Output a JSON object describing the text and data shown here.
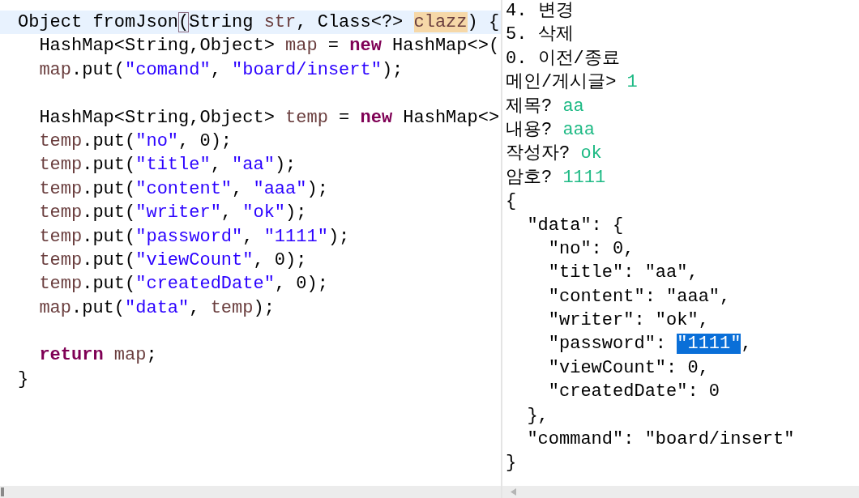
{
  "editor": {
    "lines": [
      {
        "current": true,
        "tokens": [
          {
            "kind": "plain",
            "text": "Object fromJson"
          },
          {
            "kind": "bracket",
            "text": "("
          },
          {
            "kind": "plain",
            "text": "String "
          },
          {
            "kind": "var",
            "text": "str"
          },
          {
            "kind": "plain",
            "text": ", Class<?> "
          },
          {
            "kind": "param",
            "text": "clazz"
          },
          {
            "kind": "plain",
            "text": ") {"
          }
        ]
      },
      {
        "current": false,
        "tokens": [
          {
            "kind": "plain",
            "text": "  HashMap<String,Object> "
          },
          {
            "kind": "var",
            "text": "map"
          },
          {
            "kind": "plain",
            "text": " = "
          },
          {
            "kind": "keyword",
            "text": "new"
          },
          {
            "kind": "plain",
            "text": " HashMap<>("
          }
        ]
      },
      {
        "current": false,
        "tokens": [
          {
            "kind": "var",
            "text": "  map"
          },
          {
            "kind": "plain",
            "text": ".put("
          },
          {
            "kind": "string",
            "text": "\"comand\""
          },
          {
            "kind": "plain",
            "text": ", "
          },
          {
            "kind": "string",
            "text": "\"board/insert\""
          },
          {
            "kind": "plain",
            "text": ");"
          }
        ]
      },
      {
        "current": false
      },
      {
        "current": false,
        "tokens": [
          {
            "kind": "plain",
            "text": "  HashMap<String,Object> "
          },
          {
            "kind": "var",
            "text": "temp"
          },
          {
            "kind": "plain",
            "text": " = "
          },
          {
            "kind": "keyword",
            "text": "new"
          },
          {
            "kind": "plain",
            "text": " HashMap<>"
          }
        ]
      },
      {
        "current": false,
        "tokens": [
          {
            "kind": "var",
            "text": "  temp"
          },
          {
            "kind": "plain",
            "text": ".put("
          },
          {
            "kind": "string",
            "text": "\"no\""
          },
          {
            "kind": "plain",
            "text": ", 0);"
          }
        ]
      },
      {
        "current": false,
        "tokens": [
          {
            "kind": "var",
            "text": "  temp"
          },
          {
            "kind": "plain",
            "text": ".put("
          },
          {
            "kind": "string",
            "text": "\"title\""
          },
          {
            "kind": "plain",
            "text": ", "
          },
          {
            "kind": "string",
            "text": "\"aa\""
          },
          {
            "kind": "plain",
            "text": ");"
          }
        ]
      },
      {
        "current": false,
        "tokens": [
          {
            "kind": "var",
            "text": "  temp"
          },
          {
            "kind": "plain",
            "text": ".put("
          },
          {
            "kind": "string",
            "text": "\"content\""
          },
          {
            "kind": "plain",
            "text": ", "
          },
          {
            "kind": "string",
            "text": "\"aaa\""
          },
          {
            "kind": "plain",
            "text": ");"
          }
        ]
      },
      {
        "current": false,
        "tokens": [
          {
            "kind": "var",
            "text": "  temp"
          },
          {
            "kind": "plain",
            "text": ".put("
          },
          {
            "kind": "string",
            "text": "\"writer\""
          },
          {
            "kind": "plain",
            "text": ", "
          },
          {
            "kind": "string",
            "text": "\"ok\""
          },
          {
            "kind": "plain",
            "text": ");"
          }
        ]
      },
      {
        "current": false,
        "tokens": [
          {
            "kind": "var",
            "text": "  temp"
          },
          {
            "kind": "plain",
            "text": ".put("
          },
          {
            "kind": "string",
            "text": "\"password\""
          },
          {
            "kind": "plain",
            "text": ", "
          },
          {
            "kind": "string",
            "text": "\"1111\""
          },
          {
            "kind": "plain",
            "text": ");"
          }
        ]
      },
      {
        "current": false,
        "tokens": [
          {
            "kind": "var",
            "text": "  temp"
          },
          {
            "kind": "plain",
            "text": ".put("
          },
          {
            "kind": "string",
            "text": "\"viewCount\""
          },
          {
            "kind": "plain",
            "text": ", 0);"
          }
        ]
      },
      {
        "current": false,
        "tokens": [
          {
            "kind": "var",
            "text": "  temp"
          },
          {
            "kind": "plain",
            "text": ".put("
          },
          {
            "kind": "string",
            "text": "\"createdDate\""
          },
          {
            "kind": "plain",
            "text": ", 0);"
          }
        ]
      },
      {
        "current": false,
        "tokens": [
          {
            "kind": "var",
            "text": "  map"
          },
          {
            "kind": "plain",
            "text": ".put("
          },
          {
            "kind": "string",
            "text": "\"data\""
          },
          {
            "kind": "plain",
            "text": ", "
          },
          {
            "kind": "var",
            "text": "temp"
          },
          {
            "kind": "plain",
            "text": ");"
          }
        ]
      },
      {
        "current": false
      },
      {
        "current": false,
        "tokens": [
          {
            "kind": "keyword",
            "text": "  return"
          },
          {
            "kind": "var",
            "text": " map"
          },
          {
            "kind": "plain",
            "text": ";"
          }
        ]
      },
      {
        "current": false,
        "tokens": [
          {
            "kind": "plain",
            "text": "}"
          }
        ]
      }
    ]
  },
  "console": {
    "lines": [
      [
        {
          "kind": "output",
          "text": "4. 변경"
        }
      ],
      [
        {
          "kind": "output",
          "text": "5. 삭제"
        }
      ],
      [
        {
          "kind": "output",
          "text": "0. 이전/종료"
        }
      ],
      [
        {
          "kind": "output",
          "text": "메인/게시글> "
        },
        {
          "kind": "input",
          "text": "1"
        }
      ],
      [
        {
          "kind": "output",
          "text": "제목? "
        },
        {
          "kind": "input",
          "text": "aa"
        }
      ],
      [
        {
          "kind": "output",
          "text": "내용? "
        },
        {
          "kind": "input",
          "text": "aaa"
        }
      ],
      [
        {
          "kind": "output",
          "text": "작성자? "
        },
        {
          "kind": "input",
          "text": "ok"
        }
      ],
      [
        {
          "kind": "output",
          "text": "암호? "
        },
        {
          "kind": "input",
          "text": "1111"
        }
      ],
      [
        {
          "kind": "output",
          "text": "{"
        }
      ],
      [
        {
          "kind": "output",
          "text": "  \"data\": {"
        }
      ],
      [
        {
          "kind": "output",
          "text": "    \"no\": 0,"
        }
      ],
      [
        {
          "kind": "output",
          "text": "    \"title\": \"aa\","
        }
      ],
      [
        {
          "kind": "output",
          "text": "    \"content\": \"aaa\","
        }
      ],
      [
        {
          "kind": "output",
          "text": "    \"writer\": \"ok\","
        }
      ],
      [
        {
          "kind": "output",
          "text": "    \"password\": "
        },
        {
          "kind": "selection",
          "text": "\"1111\""
        },
        {
          "kind": "output",
          "text": ","
        }
      ],
      [
        {
          "kind": "output",
          "text": "    \"viewCount\": 0,"
        }
      ],
      [
        {
          "kind": "output",
          "text": "    \"createdDate\": 0"
        }
      ],
      [
        {
          "kind": "output",
          "text": "  },"
        }
      ],
      [
        {
          "kind": "output",
          "text": "  \"command\": \"board/insert\""
        }
      ],
      [
        {
          "kind": "output",
          "text": "}"
        }
      ]
    ]
  }
}
